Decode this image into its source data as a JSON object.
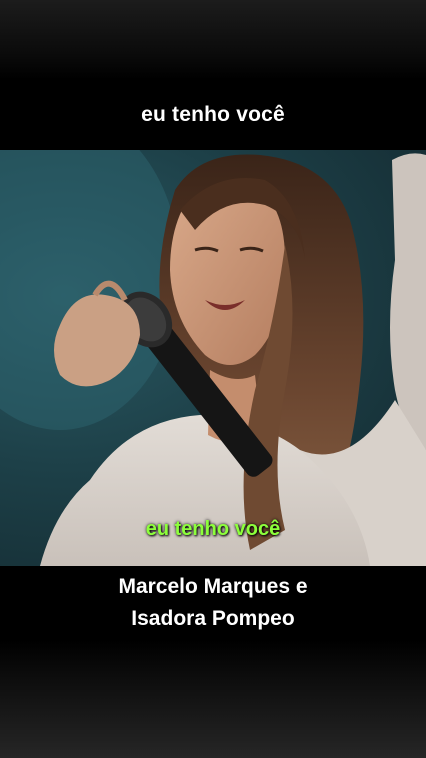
{
  "video": {
    "top_caption": "eu tenho você",
    "subtitle": "eu tenho você",
    "credits": [
      "Marcelo Marques e",
      "Isadora Pompeo"
    ]
  },
  "colors": {
    "background": "#000000",
    "subtitle_green": "#8dff3c",
    "stage_teal": "#1d4048"
  }
}
